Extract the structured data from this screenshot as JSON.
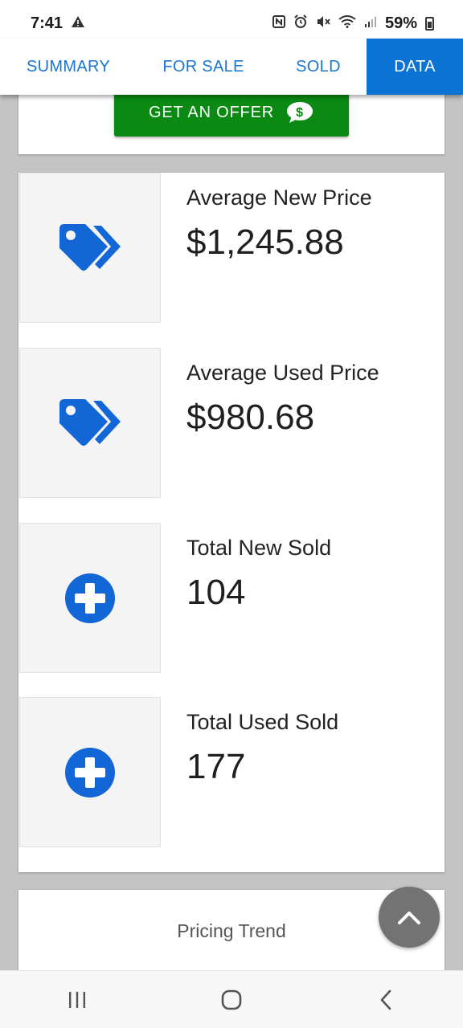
{
  "status_bar": {
    "time": "7:41",
    "battery": "59%",
    "icons": [
      "warning-icon",
      "nfc-icon",
      "alarm-icon",
      "mute-icon",
      "wifi-icon",
      "signal-icon",
      "battery-icon"
    ]
  },
  "tabs": [
    {
      "label": "SUMMARY",
      "active": false
    },
    {
      "label": "FOR SALE",
      "active": false
    },
    {
      "label": "SOLD",
      "active": false
    },
    {
      "label": "DATA",
      "active": true
    }
  ],
  "offer": {
    "button_label": "GET AN OFFER",
    "icon": "chat-dollar-icon"
  },
  "stats": [
    {
      "label": "Average New Price",
      "value": "$1,245.88",
      "icon": "tags-icon"
    },
    {
      "label": "Average Used Price",
      "value": "$980.68",
      "icon": "tags-icon"
    },
    {
      "label": "Total New Sold",
      "value": "104",
      "icon": "plus-circle-icon"
    },
    {
      "label": "Total Used Sold",
      "value": "177",
      "icon": "plus-circle-icon"
    }
  ],
  "trend": {
    "title": "Pricing Trend"
  },
  "colors": {
    "accent_blue": "#0b73d4",
    "icon_blue": "#1266d6",
    "offer_green": "#0a8a12",
    "scroll_button_gray": "#737373"
  }
}
